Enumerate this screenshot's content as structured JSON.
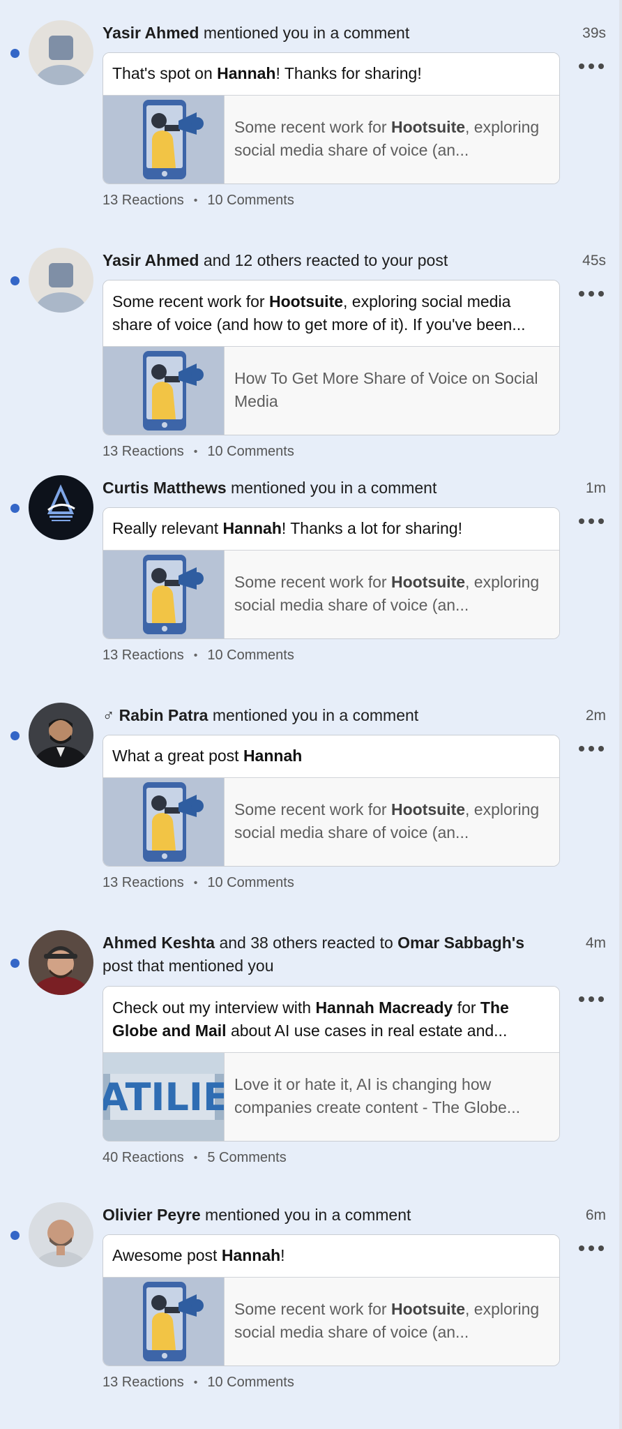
{
  "notifications": [
    {
      "time": "39s",
      "actor": "Yasir Ahmed",
      "action": "mentioned you in a comment",
      "avatar": "default-avatar",
      "comment_pre": "That's spot on ",
      "comment_bold": "Hannah",
      "comment_post": "! Thanks for sharing!",
      "preview_pre": "Some recent work for ",
      "preview_bold": "Hootsuite",
      "preview_post": ", exploring social media share of voice (an...",
      "reactions": "13 Reactions",
      "comments": "10 Comments"
    },
    {
      "time": "45s",
      "actor": "Yasir Ahmed",
      "action": "and 12 others reacted to your post",
      "avatar": "default-avatar",
      "post_pre": "Some recent work for ",
      "post_bold": "Hootsuite",
      "post_post": ", exploring social media share of voice (and how to get more of it). If you've been...",
      "preview": "How To Get More Share of Voice on Social Media",
      "reactions": "13 Reactions",
      "comments": "10 Comments"
    },
    {
      "time": "1m",
      "actor": "Curtis Matthews",
      "action": "mentioned you in a comment",
      "avatar": "curtis-logo-avatar",
      "comment_pre": "Really relevant ",
      "comment_bold": "Hannah",
      "comment_post": "! Thanks a lot for sharing!",
      "preview_pre": "Some recent work for ",
      "preview_bold": "Hootsuite",
      "preview_post": ", exploring social media share of voice (an...",
      "reactions": "13 Reactions",
      "comments": "10 Comments"
    },
    {
      "time": "2m",
      "actor_prefix": "♂",
      "actor": "Rabin Patra",
      "action": "mentioned you in a comment",
      "avatar": "rabin-photo-avatar",
      "comment_pre": "What a great post ",
      "comment_bold": "Hannah",
      "comment_post": "",
      "preview_pre": "Some recent work for ",
      "preview_bold": "Hootsuite",
      "preview_post": ", exploring social media share of voice (an...",
      "reactions": "13 Reactions",
      "comments": "10 Comments"
    },
    {
      "time": "4m",
      "actor": "Ahmed Keshta",
      "action_1": "and 38 others reacted to",
      "actor_2": "Omar Sabbagh's",
      "action_2": "post that mentioned you",
      "avatar": "ahmed-photo-avatar",
      "post_pre": "Check out my interview with ",
      "post_bold_1": "Hannah Macready",
      "post_mid": " for ",
      "post_bold_2": "The Globe and Mail",
      "post_post": " about AI use cases in real estate and...",
      "preview": "Love it or hate it, AI is changing how companies create content - The Globe...",
      "reactions": "40 Reactions",
      "comments": "5 Comments"
    },
    {
      "time": "6m",
      "actor": "Olivier Peyre",
      "action": "mentioned you in a comment",
      "avatar": "olivier-photo-avatar",
      "comment_pre": "Awesome post ",
      "comment_bold": "Hannah",
      "comment_post": "!",
      "preview_pre": "Some recent work for ",
      "preview_bold": "Hootsuite",
      "preview_post": ", exploring social media share of voice (an...",
      "reactions": "13 Reactions",
      "comments": "10 Comments"
    }
  ],
  "separator": "•",
  "colors": {
    "background": "#e7eef9",
    "unread_dot": "#3466c7",
    "card": "#ffffff",
    "preview": "#f8f8f8"
  }
}
